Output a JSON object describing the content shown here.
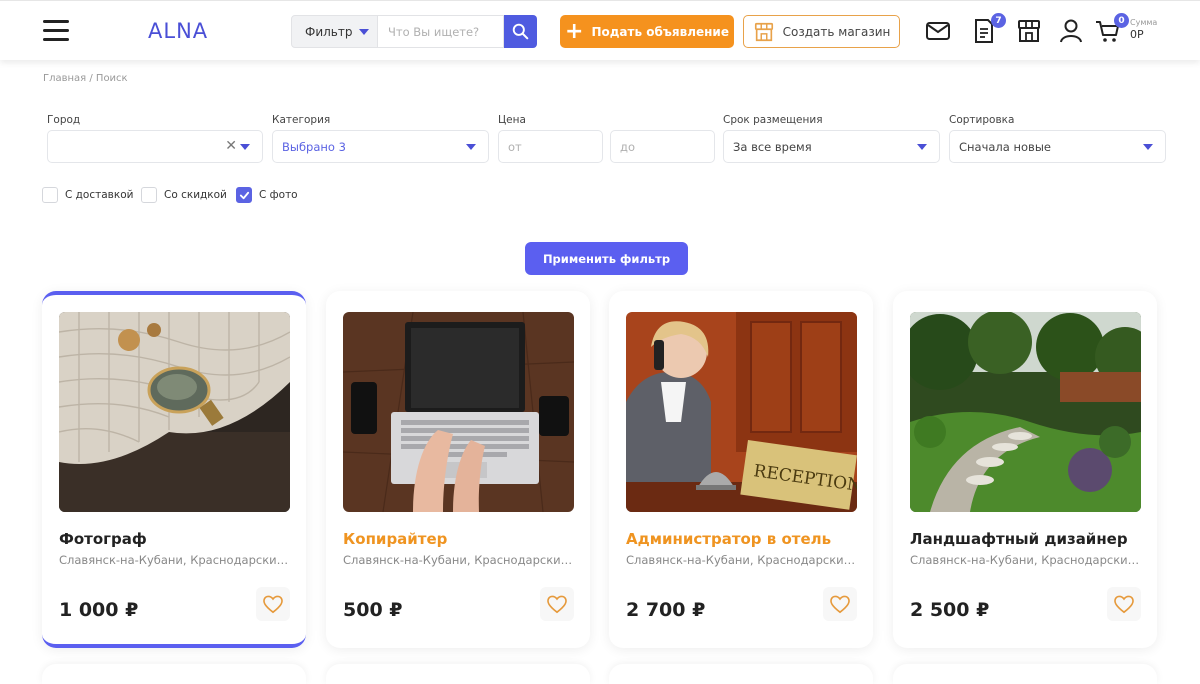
{
  "header": {
    "logo": "ALNA",
    "filter_label": "Фильтр",
    "search_placeholder": "Что Вы ищете?",
    "post_label": "Подать объявление",
    "store_label": "Создать магазин",
    "docs_badge": "7",
    "cart_badge": "0",
    "cart_sum_label": "Сумма",
    "cart_sum_value": "0Р"
  },
  "breadcrumb": "Главная / Поиск",
  "filters": {
    "city_label": "Город",
    "city_value": "",
    "category_label": "Категория",
    "category_value": "Выбрано 3",
    "price_label": "Цена",
    "price_from_placeholder": "от",
    "price_to_placeholder": "до",
    "period_label": "Срок размещения",
    "period_value": "За все время",
    "sort_label": "Сортировка",
    "sort_value": "Сначала новые"
  },
  "checkboxes": [
    {
      "label": "С доставкой",
      "checked": false
    },
    {
      "label": "Со скидкой",
      "checked": false
    },
    {
      "label": "С фото",
      "checked": true
    }
  ],
  "apply_label": "Применить фильтр",
  "cards": [
    {
      "title": "Фотограф",
      "location": "Славянск-на-Кубани, Краснодарский край",
      "price": "1 000 ₽",
      "highlight": false
    },
    {
      "title": "Копирайтер",
      "location": "Славянск-на-Кубани, Краснодарский край",
      "price": "500 ₽",
      "highlight": true
    },
    {
      "title": "Администратор в отель",
      "location": "Славянск-на-Кубани, Краснодарский край",
      "price": "2 700 ₽",
      "highlight": true
    },
    {
      "title": "Ландшафтный дизайнер",
      "location": "Славянск-на-Кубани, Краснодарский край",
      "price": "2 500 ₽",
      "highlight": false
    }
  ],
  "colors": {
    "accent": "#5b5ff0",
    "orange": "#f5921e"
  }
}
